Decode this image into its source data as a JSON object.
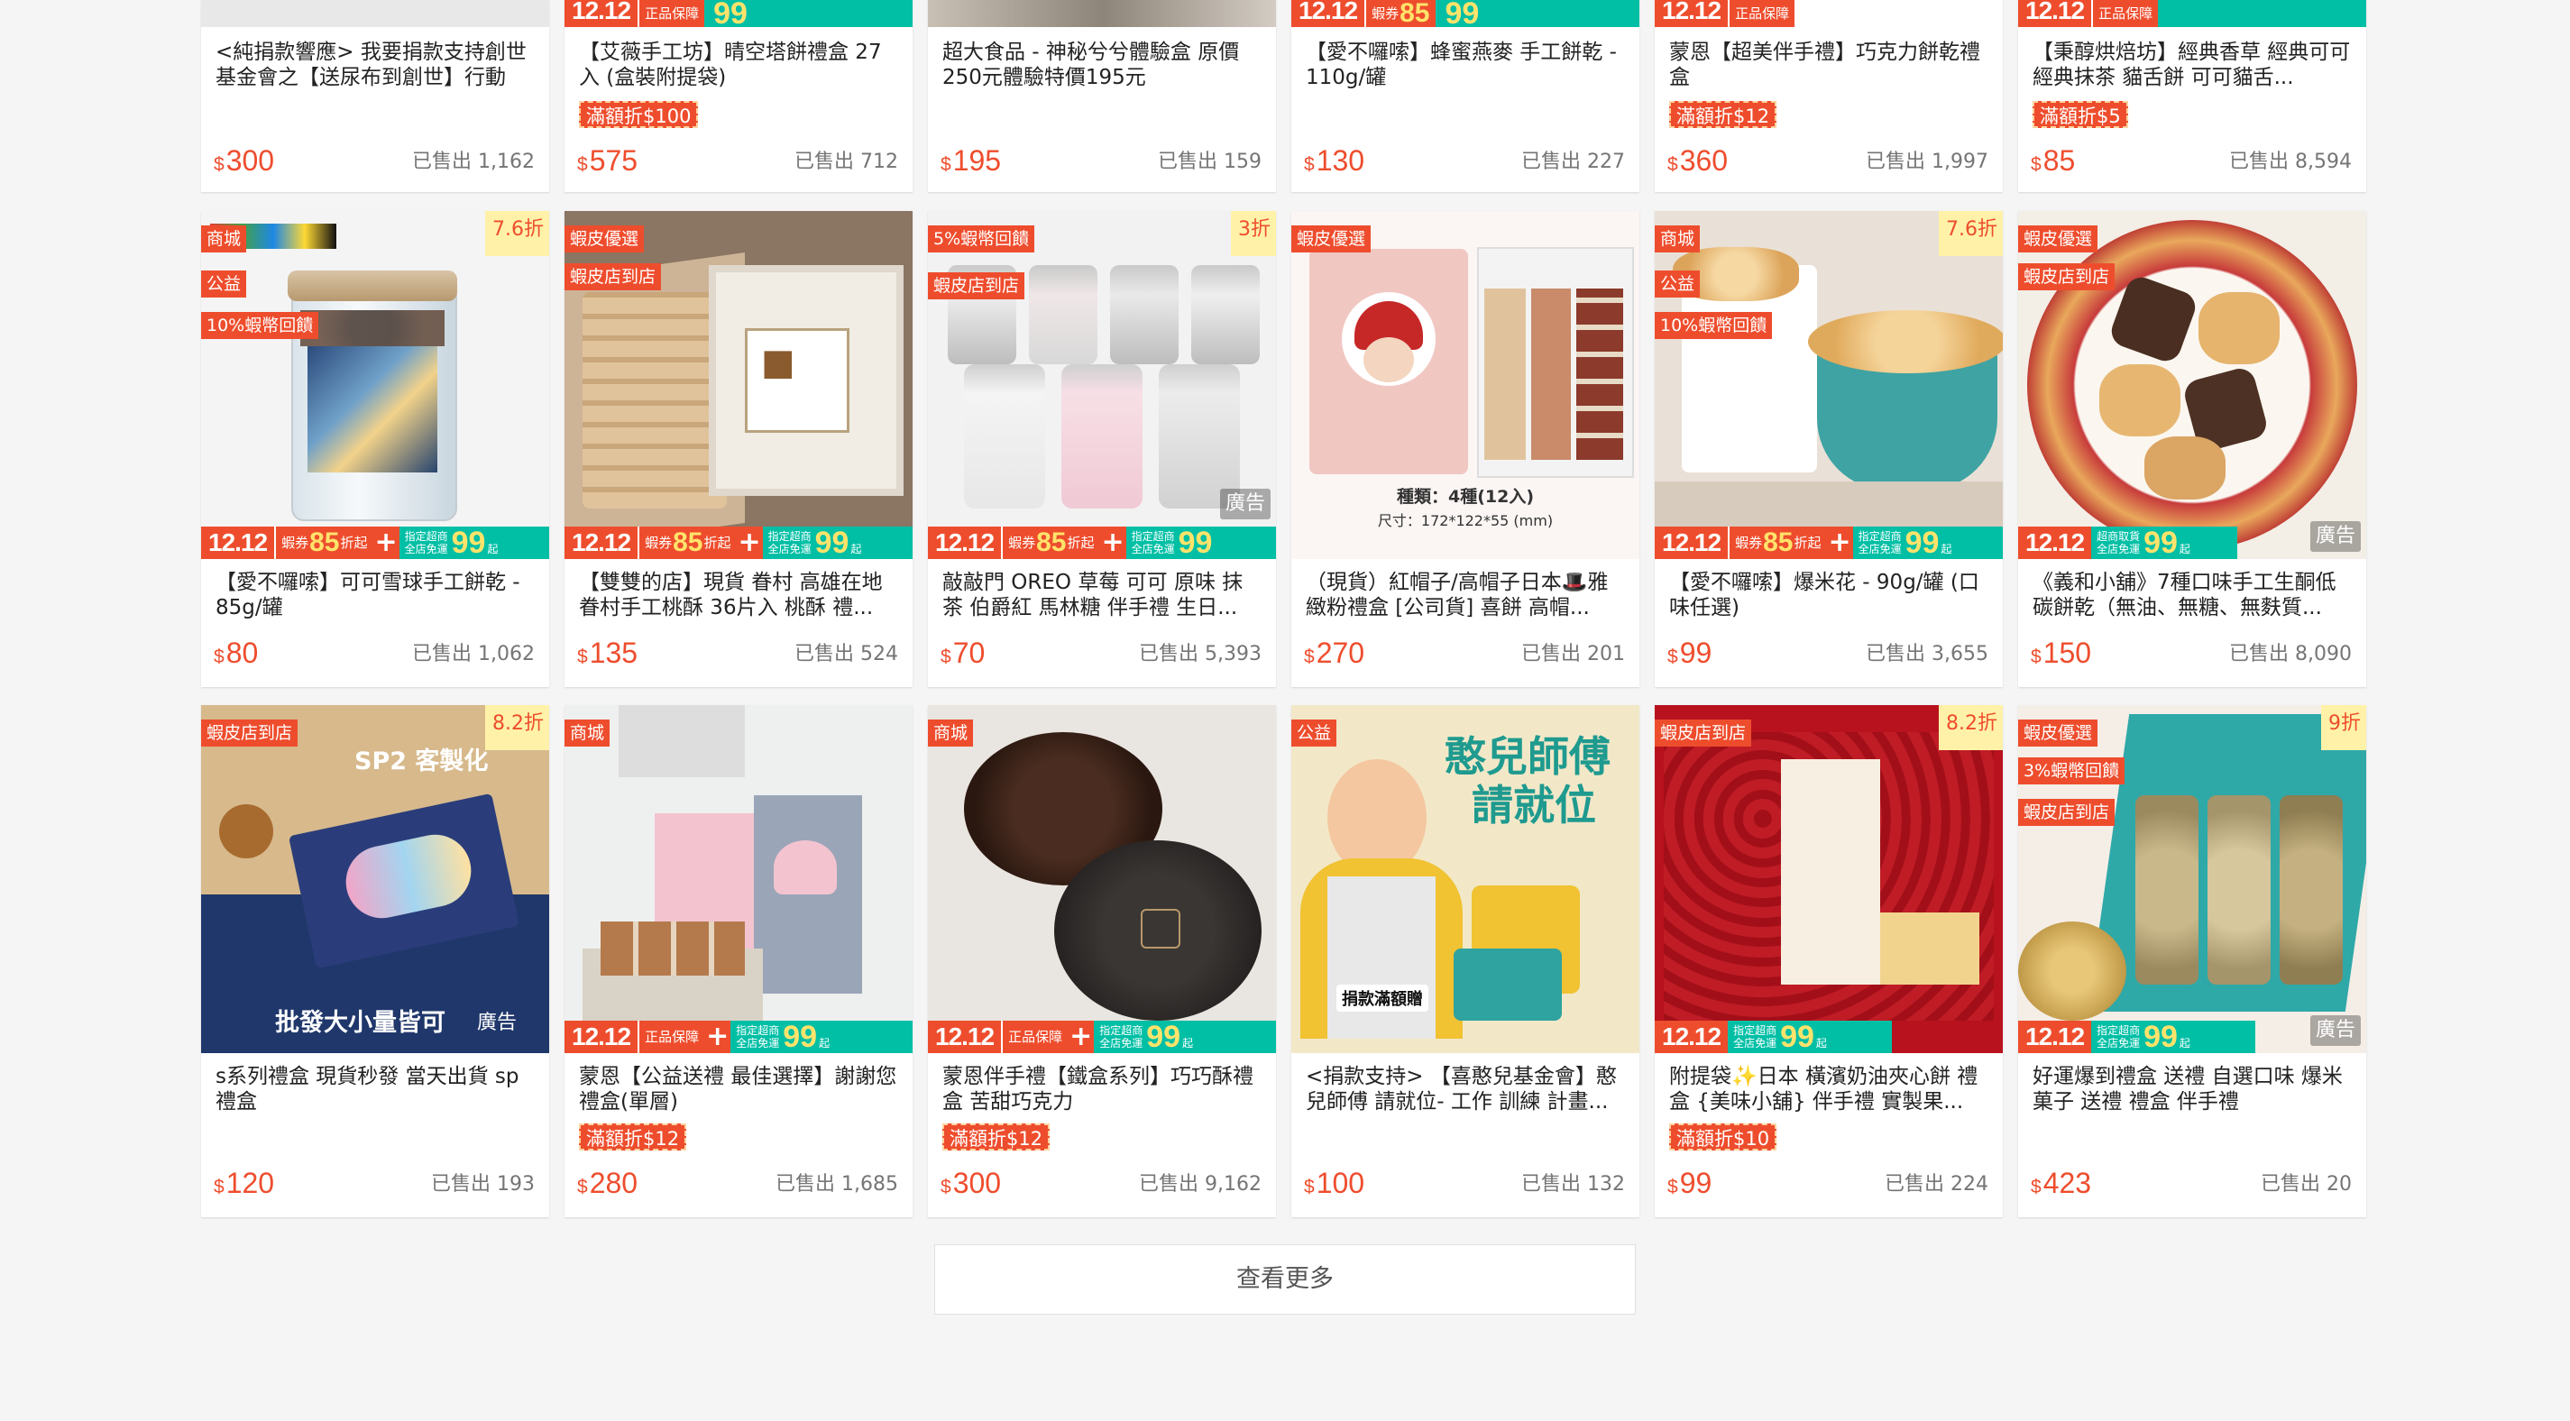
{
  "colors": {
    "accent": "#ee4d2d",
    "teal": "#00bfa5",
    "bg": "#f5f5f5"
  },
  "banner": {
    "d1212": "12.12",
    "zbbz": "正品保障",
    "xp": "蝦券",
    "xp_num": "85",
    "xp_suffix": "折起",
    "cs": "指定超商",
    "qd": "全店免運",
    "num99": "99",
    "qi": "起",
    "cs_alt": "超商取貨"
  },
  "rows": [
    [
      {
        "title": "<純捐款響應> 我要捐款支持創世基金會之【送尿布到創世】行動",
        "promo": "",
        "price": "300",
        "sold": "已售出 1,162"
      },
      {
        "title": "【艾薇手工坊】晴空塔餅禮盒 27入 (盒裝附提袋)",
        "promo": "滿額折$100",
        "price": "575",
        "sold": "已售出 712"
      },
      {
        "title": "超大食品 - 神秘兮兮體驗盒 原價250元體驗特價195元",
        "promo": "",
        "price": "195",
        "sold": "已售出 159"
      },
      {
        "title": "【愛不囉嗦】蜂蜜燕麥 手工餅乾 - 110g/罐",
        "promo": "",
        "price": "130",
        "sold": "已售出 227"
      },
      {
        "title": "蒙恩【超美伴手禮】巧克力餅乾禮盒",
        "promo": "滿額折$12",
        "price": "360",
        "sold": "已售出 1,997"
      },
      {
        "title": "【秉醇烘焙坊】經典香草 經典可可 經典抹茶 貓舌餅 可可貓舌...",
        "promo": "滿額折$5",
        "price": "85",
        "sold": "已售出 8,594"
      }
    ],
    [
      {
        "title": "【愛不囉嗦】可可雪球手工餅乾 - 85g/罐",
        "price": "80",
        "sold": "已售出 1,062",
        "tags": [
          "商城",
          "公益",
          "10%蝦幣回饋"
        ],
        "discount": "7.6折",
        "ad": ""
      },
      {
        "title": "【雙雙的店】現貨 眷村 高雄在地眷村手工桃酥 36片入 桃酥 禮...",
        "price": "135",
        "sold": "已售出 524",
        "tags": [
          "蝦皮優選",
          "蝦皮店到店"
        ],
        "discount": "",
        "ad": ""
      },
      {
        "title": "敲敲門 OREO 草莓 可可 原味 抹茶 伯爵紅 馬林糖 伴手禮 生日...",
        "price": "70",
        "sold": "已售出 5,393",
        "tags": [
          "5%蝦幣回饋",
          "蝦皮店到店"
        ],
        "discount": "3折",
        "ad": "廣告"
      },
      {
        "title": "（現貨）紅帽子/高帽子日本🎩雅緻粉禮盒 [公司貨] 喜餅 高帽...",
        "price": "270",
        "sold": "已售出 201",
        "tags": [
          "蝦皮優選"
        ],
        "discount": "",
        "ad": "",
        "img_text": [
          "種類：4種(12入)",
          "尺寸：172*122*55 (mm)"
        ]
      },
      {
        "title": "【愛不囉嗦】爆米花 - 90g/罐 (口味任選)",
        "price": "99",
        "sold": "已售出 3,655",
        "tags": [
          "商城",
          "公益",
          "10%蝦幣回饋"
        ],
        "discount": "7.6折",
        "ad": ""
      },
      {
        "title": "《義和小舖》7種口味手工生酮低碳餅乾（無油、無糖、無麩質...",
        "price": "150",
        "sold": "已售出 8,090",
        "tags": [
          "蝦皮優選",
          "蝦皮店到店"
        ],
        "discount": "",
        "ad": "廣告"
      }
    ],
    [
      {
        "title": "s系列禮盒 現貨秒發 當天出貨 sp禮盒",
        "promo": "",
        "price": "120",
        "sold": "已售出 193",
        "tags": [
          "蝦皮店到店"
        ],
        "discount": "8.2折",
        "img_text": [
          "SP2 客製化",
          "批發大小量皆可",
          "廣告"
        ]
      },
      {
        "title": "蒙恩【公益送禮 最佳選擇】謝謝您禮盒(單層)",
        "promo": "滿額折$12",
        "price": "280",
        "sold": "已售出 1,685",
        "tags": [
          "商城"
        ],
        "discount": ""
      },
      {
        "title": "蒙恩伴手禮【鐵盒系列】巧巧酥禮盒 苦甜巧克力",
        "promo": "滿額折$12",
        "price": "300",
        "sold": "已售出 9,162",
        "tags": [
          "商城"
        ],
        "discount": ""
      },
      {
        "title": "<捐款支持> 【喜憨兒基金會】憨兒師傅 請就位- 工作 訓練 計畫...",
        "promo": "",
        "price": "100",
        "sold": "已售出 132",
        "tags": [
          "公益"
        ],
        "discount": "",
        "img_text": [
          "憨兒師傅",
          "請就位",
          "捐款滿額贈"
        ]
      },
      {
        "title": "附提袋✨日本 橫濱奶油夾心餅 禮盒 {美味小舖} 伴手禮 實製果...",
        "promo": "滿額折$10",
        "price": "99",
        "sold": "已售出 224",
        "tags": [
          "蝦皮店到店"
        ],
        "discount": "8.2折"
      },
      {
        "title": "好運爆到禮盒 送禮 自選口味 爆米菓子 送禮 禮盒 伴手禮",
        "promo": "",
        "price": "423",
        "sold": "已售出 20",
        "tags": [
          "蝦皮優選",
          "3%蝦幣回饋",
          "蝦皮店到店"
        ],
        "discount": "9折",
        "ad": "廣告"
      }
    ]
  ],
  "currency": "$",
  "see_more": "查看更多"
}
